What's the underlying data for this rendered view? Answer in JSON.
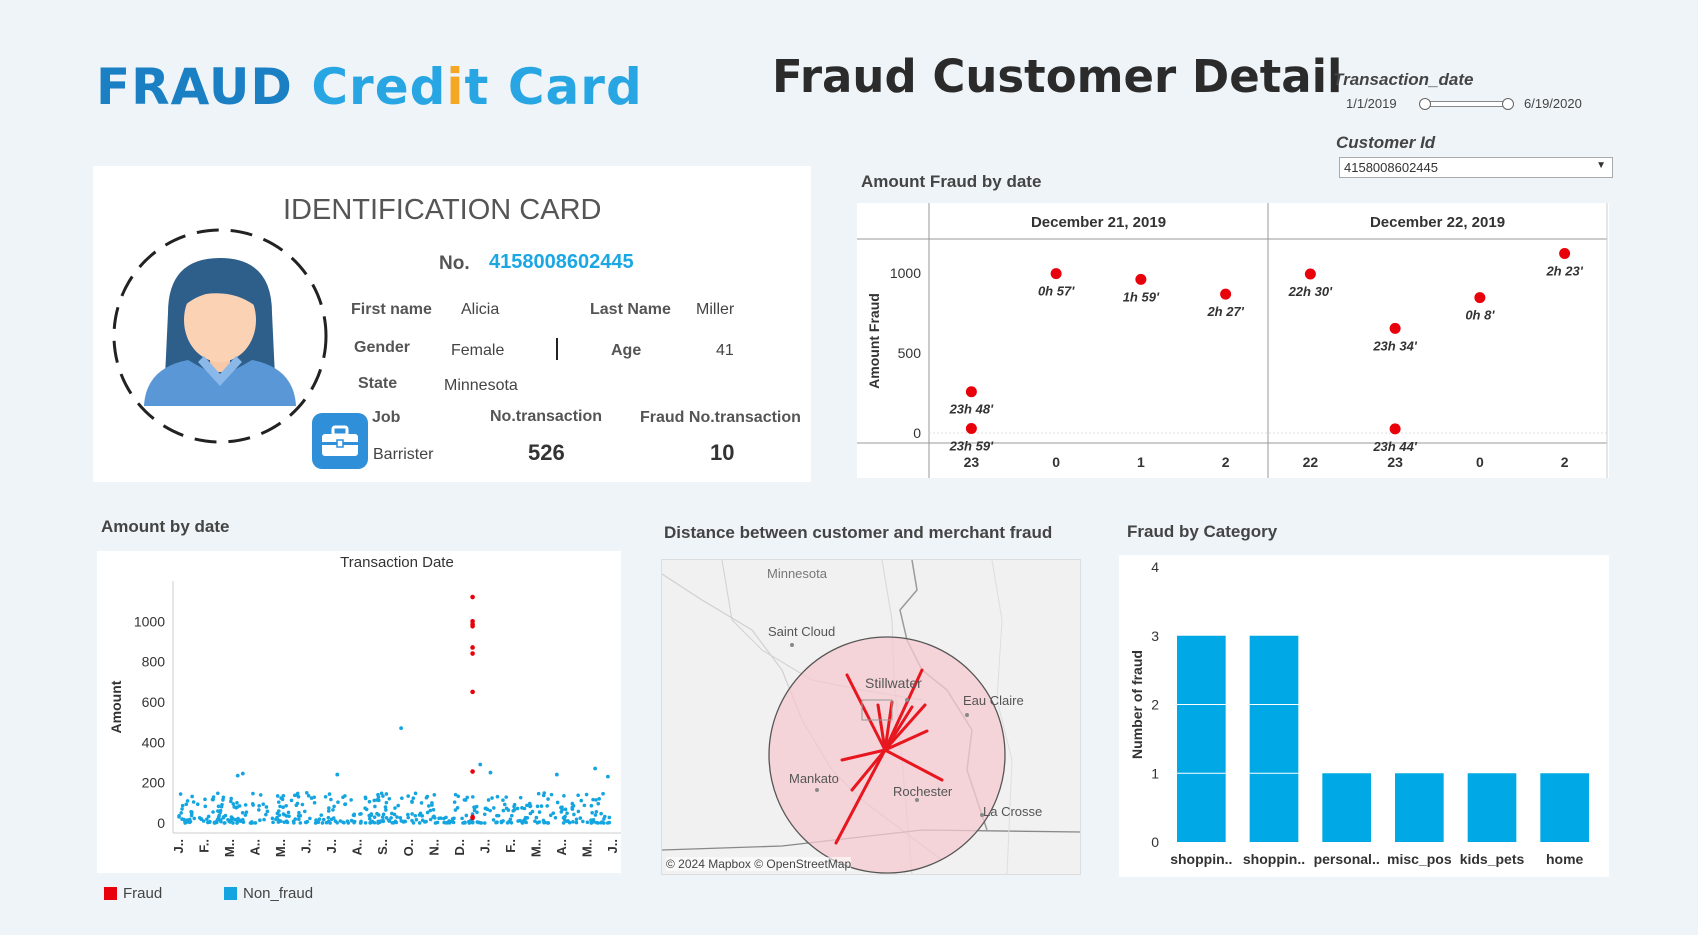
{
  "header": {
    "logo_word1": "FRAUD",
    "logo_word2a": "Cred",
    "logo_word2b": "i",
    "logo_word2c": "t Card",
    "title": "Fraud Customer Detail"
  },
  "filters": {
    "transaction_date_label": "Transaction_date",
    "date_start": "1/1/2019",
    "date_end": "6/19/2020",
    "customer_id_label": "Customer Id",
    "customer_id_value": "4158008602445"
  },
  "id_card": {
    "title": "IDENTIFICATION CARD",
    "no_label": "No.",
    "no_value": "4158008602445",
    "first_name_label": "First name",
    "first_name": "Alicia",
    "last_name_label": "Last Name",
    "last_name": "Miller",
    "gender_label": "Gender",
    "gender": "Female",
    "age_label": "Age",
    "age": "41",
    "state_label": "State",
    "state": "Minnesota",
    "job_label": "Job",
    "job": "Barrister",
    "no_transaction_label": "No.transaction",
    "no_transaction": "526",
    "fraud_no_transaction_label": "Fraud No.transaction",
    "fraud_no_transaction": "10"
  },
  "amount_fraud_by_date": {
    "title": "Amount Fraud by date",
    "chart_data": {
      "type": "scatter",
      "ylabel": "Amount Fraud",
      "ylim": [
        0,
        1150
      ],
      "yticks": [
        0,
        500,
        1000
      ],
      "groups": [
        {
          "date": "December 21, 2019",
          "hours": [
            "23",
            "0",
            "1",
            "2"
          ]
        },
        {
          "date": "December 22, 2019",
          "hours": [
            "22",
            "23",
            "0",
            "2"
          ]
        }
      ],
      "points": [
        {
          "group": 0,
          "hour_index": 0,
          "amount": 258,
          "label": "23h 48'"
        },
        {
          "group": 0,
          "hour_index": 0,
          "amount": 28,
          "label": "23h 59'"
        },
        {
          "group": 0,
          "hour_index": 1,
          "amount": 996,
          "label": "0h 57'"
        },
        {
          "group": 0,
          "hour_index": 2,
          "amount": 960,
          "label": "1h 59'"
        },
        {
          "group": 0,
          "hour_index": 3,
          "amount": 868,
          "label": "2h 27'"
        },
        {
          "group": 1,
          "hour_index": 0,
          "amount": 994,
          "label": "22h 30'"
        },
        {
          "group": 1,
          "hour_index": 1,
          "amount": 654,
          "label": "23h 34'"
        },
        {
          "group": 1,
          "hour_index": 1,
          "amount": 26,
          "label": "23h 44'"
        },
        {
          "group": 1,
          "hour_index": 2,
          "amount": 846,
          "label": "0h 8'"
        },
        {
          "group": 1,
          "hour_index": 3,
          "amount": 1122,
          "label": "2h 23'"
        }
      ],
      "color": "#e8000b"
    }
  },
  "amount_by_date": {
    "title": "Amount by date",
    "chart_data": {
      "type": "scatter",
      "title": "Transaction Date",
      "ylabel": "Amount",
      "ylim": [
        0,
        1150
      ],
      "yticks": [
        0,
        200,
        400,
        600,
        800,
        1000
      ],
      "x_ticks": [
        "J..",
        "F..",
        "M..",
        "A..",
        "M..",
        "J..",
        "J..",
        "A..",
        "S..",
        "O..",
        "N..",
        "D..",
        "J..",
        "F..",
        "M..",
        "A..",
        "M..",
        "J.."
      ],
      "fraud_points": {
        "month_index": 11.5,
        "amounts": [
          1120,
          1000,
          985,
          975,
          870,
          840,
          650,
          255,
          30,
          25
        ]
      },
      "non_fraud_notable": [
        {
          "month_index": 2.3,
          "amount": 235
        },
        {
          "month_index": 2.5,
          "amount": 245
        },
        {
          "month_index": 6.2,
          "amount": 240
        },
        {
          "month_index": 8.7,
          "amount": 470
        },
        {
          "month_index": 11.8,
          "amount": 290
        },
        {
          "month_index": 12.2,
          "amount": 250
        },
        {
          "month_index": 16.3,
          "amount": 270
        },
        {
          "month_index": 16.8,
          "amount": 230
        },
        {
          "month_index": 14.8,
          "amount": 240
        }
      ],
      "non_fraud_typical_range": [
        0,
        150
      ],
      "legend": [
        {
          "name": "Fraud",
          "color": "#e8000b"
        },
        {
          "name": "Non_fraud",
          "color": "#14a5e0"
        }
      ]
    }
  },
  "distance_map": {
    "title": "Distance between customer and merchant fraud",
    "cities": [
      "Minnesota",
      "Saint Cloud",
      "Stillwater",
      "Eau Claire",
      "Mankato",
      "Rochester",
      "La Crosse"
    ],
    "attribution": "© 2024 Mapbox © OpenStreetMap",
    "circle_color": "#f4c9cf",
    "line_color": "#e8161f"
  },
  "fraud_by_category": {
    "title": "Fraud by Category",
    "chart_data": {
      "type": "bar",
      "ylabel": "Number of fraud",
      "ylim": [
        0,
        4
      ],
      "yticks": [
        0,
        1,
        2,
        3,
        4
      ],
      "categories": [
        "shoppin..",
        "shoppin..",
        "personal..",
        "misc_pos",
        "kids_pets",
        "home"
      ],
      "values": [
        3,
        3,
        1,
        1,
        1,
        1
      ],
      "color": "#00a8e6"
    }
  }
}
